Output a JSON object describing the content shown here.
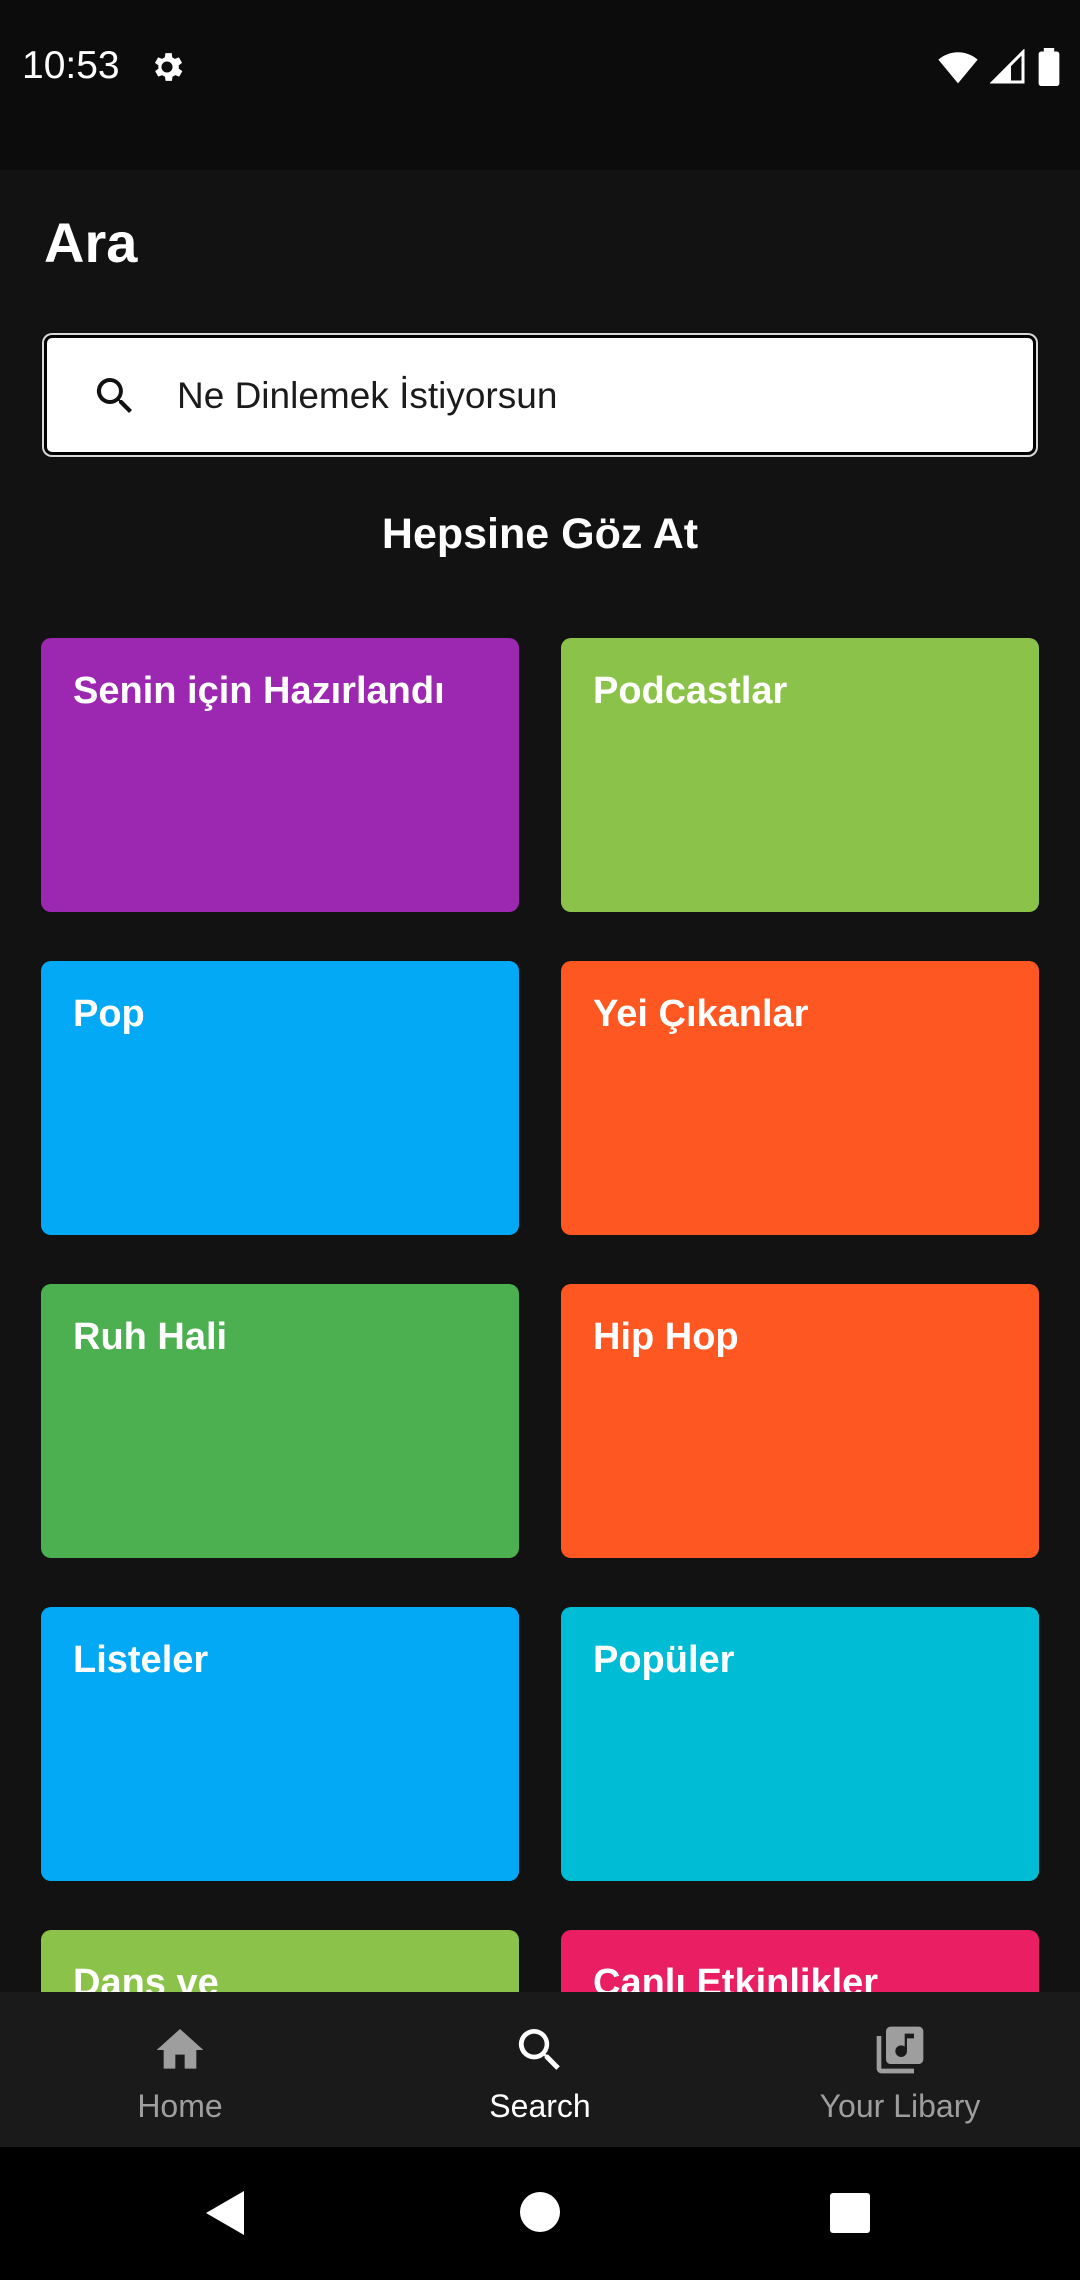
{
  "status_bar": {
    "time": "10:53",
    "icons": [
      "settings-icon",
      "wifi-icon",
      "signal-icon",
      "battery-icon"
    ]
  },
  "header": {
    "title": "Ara"
  },
  "search": {
    "placeholder": "Ne Dinlemek İstiyorsun"
  },
  "section": {
    "title": "Hepsine Göz At"
  },
  "categories": [
    {
      "label": "Senin için Hazırlandı",
      "color": "#9c27b0"
    },
    {
      "label": "Podcastlar",
      "color": "#8bc34a"
    },
    {
      "label": "Pop",
      "color": "#03a9f4"
    },
    {
      "label": "Yei Çıkanlar",
      "color": "#ff5722"
    },
    {
      "label": "Ruh Hali",
      "color": "#4caf50"
    },
    {
      "label": "Hip Hop",
      "color": "#ff5722"
    },
    {
      "label": "Listeler",
      "color": "#03a9f4"
    },
    {
      "label": "Popüler",
      "color": "#00bcd4"
    },
    {
      "label": "Dans ve",
      "color": "#8bc34a"
    },
    {
      "label": "Canlı Etkinlikler",
      "color": "#e91e63"
    }
  ],
  "bottom_nav": [
    {
      "label": "Home",
      "icon": "home-icon",
      "active": false
    },
    {
      "label": "Search",
      "icon": "search-icon",
      "active": true
    },
    {
      "label": "Your Libary",
      "icon": "library-icon",
      "active": false
    }
  ],
  "system_nav": [
    "back-icon",
    "home-circle-icon",
    "recents-icon"
  ]
}
